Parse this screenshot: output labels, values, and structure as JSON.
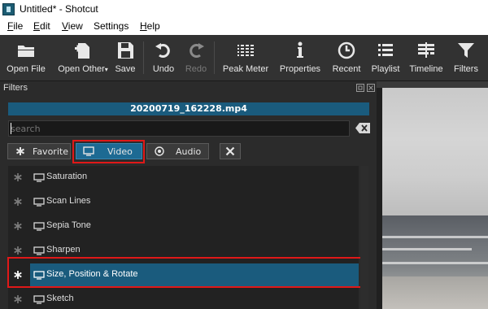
{
  "window": {
    "title": "Untitled* - Shotcut"
  },
  "menu": [
    {
      "key": "F",
      "rest": "ile"
    },
    {
      "key": "E",
      "rest": "dit"
    },
    {
      "key": "V",
      "rest": "iew"
    },
    {
      "key": "",
      "rest": "Settings"
    },
    {
      "key": "H",
      "rest": "elp"
    }
  ],
  "toolbar": {
    "open_file": "Open File",
    "open_other": "Open Other",
    "save": "Save",
    "undo": "Undo",
    "redo": "Redo",
    "peak_meter": "Peak Meter",
    "properties": "Properties",
    "recent": "Recent",
    "playlist": "Playlist",
    "timeline": "Timeline",
    "filters": "Filters"
  },
  "filters_panel": {
    "title": "Filters",
    "clip_name": "20200719_162228.mp4",
    "search": {
      "value": "",
      "placeholder": "search"
    },
    "tabs": {
      "favorite": "Favorite",
      "video": "Video",
      "audio": "Audio",
      "active": "Video"
    },
    "items": [
      {
        "name": "Saturation",
        "selected": false
      },
      {
        "name": "Scan Lines",
        "selected": false
      },
      {
        "name": "Sepia Tone",
        "selected": false
      },
      {
        "name": "Sharpen",
        "selected": false
      },
      {
        "name": "Size, Position & Rotate",
        "selected": true
      },
      {
        "name": "Sketch",
        "selected": false
      }
    ]
  },
  "colors": {
    "accent": "#1a5b7d",
    "highlight": "#e01818"
  }
}
